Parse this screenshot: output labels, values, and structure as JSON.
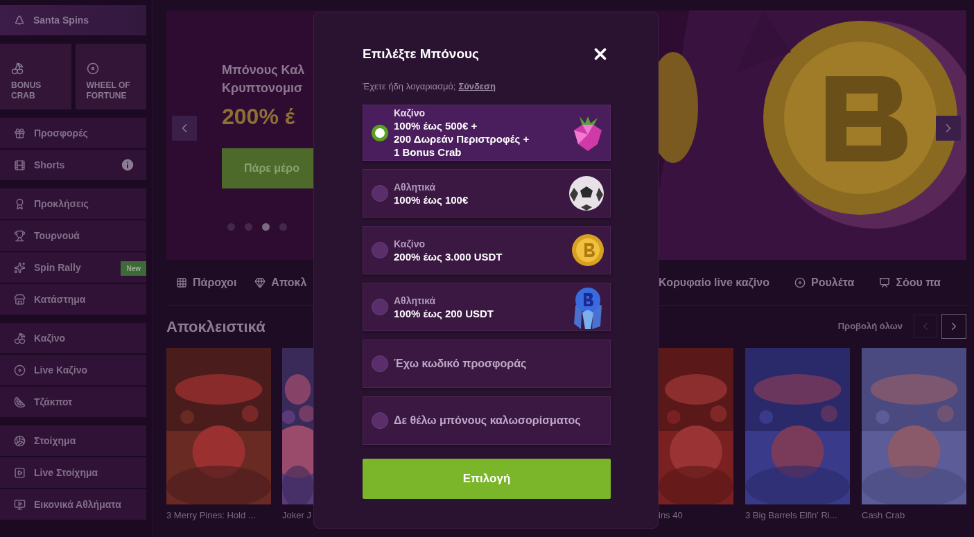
{
  "sidebar": {
    "featured": {
      "label": "Santa Spins"
    },
    "tiles": [
      {
        "label": "BONUS CRAB"
      },
      {
        "label": "WHEEL OF FORTUNE"
      }
    ],
    "groups": [
      [
        {
          "label": "Προσφορές"
        },
        {
          "label": "Shorts",
          "info": true
        }
      ],
      [
        {
          "label": "Προκλήσεις"
        },
        {
          "label": "Τουρνουά"
        },
        {
          "label": "Spin Rally",
          "badge": "New"
        },
        {
          "label": "Κατάστημα"
        }
      ],
      [
        {
          "label": "Καζίνο"
        },
        {
          "label": "Live Καζίνο"
        },
        {
          "label": "Τζάκποτ"
        }
      ],
      [
        {
          "label": "Στοίχημα"
        },
        {
          "label": "Live Στοίχημα"
        },
        {
          "label": "Εικονικά Αθλήματα"
        }
      ]
    ]
  },
  "hero": {
    "title_lines": [
      "Μπόνους Καλ",
      "Κρυπτονομισ"
    ],
    "headline": "200% έ",
    "cta": "Πάρε μέρο",
    "dots": [
      {
        "selected": false
      },
      {
        "selected": false
      },
      {
        "selected": true
      },
      {
        "selected": false
      }
    ]
  },
  "category_tabs": [
    {
      "label": "Πάροχοι"
    },
    {
      "label": "Αποκλ"
    },
    {
      "label": "Κορυφαίο live καζίνο"
    },
    {
      "label": "Ρουλέτα"
    },
    {
      "label": "Σόου πα"
    }
  ],
  "section": {
    "title": "Αποκλειστικά",
    "view_all": "Προβολή όλων",
    "prev_disabled": true,
    "games": [
      {
        "title": "3 Merry Pines: Hold ..."
      },
      {
        "title": "Joker J"
      },
      {
        "title": "ins 40"
      },
      {
        "title": "3 Big Barrels Elfin' Ri..."
      },
      {
        "title": "Cash Crab"
      }
    ]
  },
  "modal": {
    "title": "Επιλέξτε Μπόνους",
    "account_prompt": "Έχετε ήδη λογαριασμό;",
    "login_link": "Σύνδεση",
    "options": [
      {
        "kind": "bonus",
        "category": "Καζίνο",
        "lines": [
          "100% έως 500€ +",
          "200 Δωρεάν Περιστροφές +",
          "1 Bonus Crab"
        ],
        "selected": true
      },
      {
        "kind": "bonus",
        "category": "Αθλητικά",
        "lines": [
          "100% έως 100€"
        ],
        "selected": false
      },
      {
        "kind": "bonus",
        "category": "Καζίνο",
        "lines": [
          "200% έως 3.000 USDT"
        ],
        "selected": false
      },
      {
        "kind": "bonus",
        "category": "Αθλητικά",
        "lines": [
          "100% έως 200 USDT"
        ],
        "selected": false
      },
      {
        "kind": "plain",
        "label": "Έχω κωδικό προσφοράς",
        "selected": false
      },
      {
        "kind": "plain",
        "label": "Δε θέλω μπόνους καλωσορίσματος",
        "selected": false
      }
    ],
    "submit": "Επιλογή"
  }
}
